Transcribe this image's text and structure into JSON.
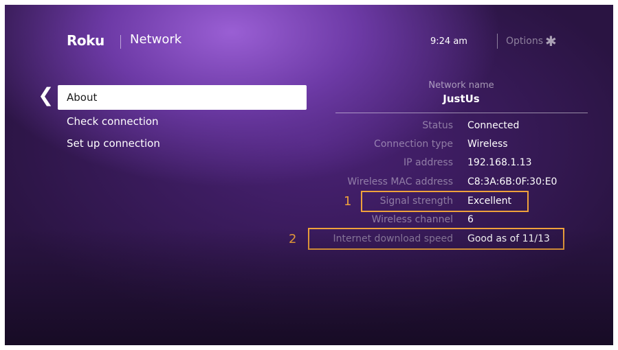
{
  "header": {
    "logo_text": "Roku",
    "title": "Network",
    "time": "9:24 am",
    "options_label": "Options",
    "options_icon": "asterisk-icon"
  },
  "sidebar": {
    "back_icon": "chevron-left-icon",
    "items": [
      {
        "label": "About",
        "selected": true
      },
      {
        "label": "Check connection",
        "selected": false
      },
      {
        "label": "Set up connection",
        "selected": false
      }
    ]
  },
  "network": {
    "name_label": "Network name",
    "name_value": "JustUs",
    "rows": [
      {
        "label": "Status",
        "value": "Connected"
      },
      {
        "label": "Connection type",
        "value": "Wireless"
      },
      {
        "label": "IP address",
        "value": "192.168.1.13"
      },
      {
        "label": "Wireless MAC address",
        "value": "C8:3A:6B:0F:30:E0"
      },
      {
        "label": "Signal strength",
        "value": "Excellent"
      },
      {
        "label": "Wireless channel",
        "value": "6"
      },
      {
        "label": "Internet download speed",
        "value": "Good as of 11/13"
      }
    ]
  },
  "annotations": {
    "color": "#f0a23b",
    "markers": [
      {
        "number": "1",
        "target": "Signal strength"
      },
      {
        "number": "2",
        "target": "Internet download speed"
      }
    ]
  },
  "colors": {
    "background_accent": "#6d3aa6",
    "highlight": "#f0a23b"
  }
}
